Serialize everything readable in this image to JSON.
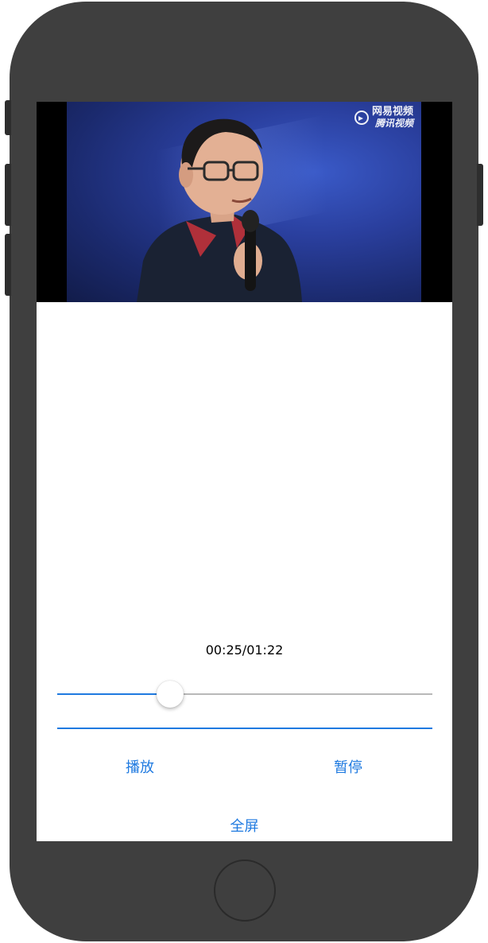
{
  "video": {
    "watermark_line1": "网易视频",
    "watermark_line2": "腾讯视频"
  },
  "player": {
    "time_display": "00:25/01:22",
    "slider_fraction": 0.3,
    "progress_fraction": 1.0
  },
  "controls": {
    "play_label": "播放",
    "pause_label": "暂停",
    "fullscreen_label": "全屏"
  },
  "colors": {
    "accent": "#1f7ae0",
    "phone_body": "#3f3f3f",
    "track_gray": "#b8b8b8"
  }
}
